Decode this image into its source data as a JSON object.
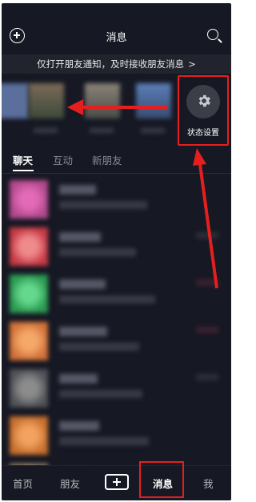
{
  "header": {
    "add_icon": "plus-circle-icon",
    "title": "消息",
    "search_icon": "search-icon"
  },
  "banner": {
    "text": "仅打开朋友通知，及时接收朋友消息",
    "chevron": ">"
  },
  "stories": {
    "status_setting": {
      "icon": "gear-icon",
      "label": "状态设置"
    }
  },
  "tabs": [
    {
      "label": "聊天",
      "active": true
    },
    {
      "label": "互动",
      "active": false
    },
    {
      "label": "新朋友",
      "active": false
    }
  ],
  "bottom_nav": {
    "items": [
      {
        "label": "首页"
      },
      {
        "label": "朋友"
      },
      {
        "label": "消息",
        "active": true
      },
      {
        "label": "我"
      }
    ],
    "add_icon": "plus-icon"
  },
  "colors": {
    "background": "#161823",
    "highlight": "#e51f1f",
    "banner_bg": "#21232d",
    "accent_cyan": "#25f4ee",
    "accent_red": "#fe2c55"
  }
}
